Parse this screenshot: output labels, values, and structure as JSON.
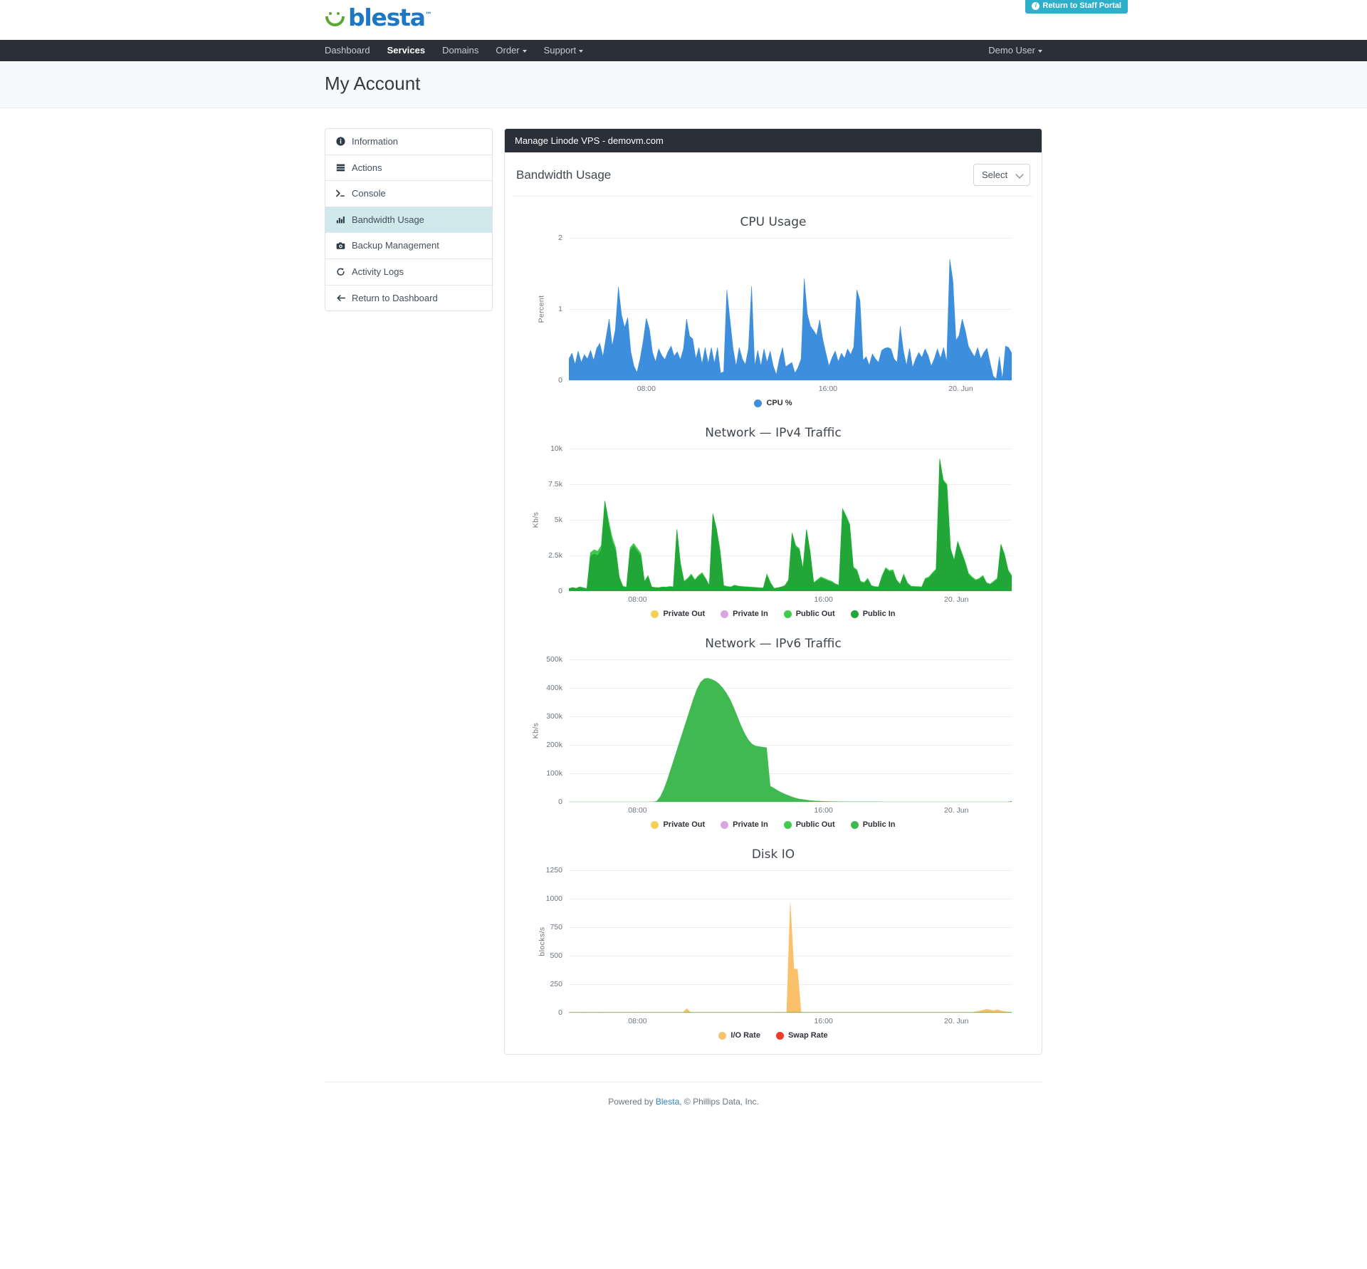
{
  "brand": {
    "logo_text": "blesta",
    "trademark": "™"
  },
  "staff_portal": {
    "label": "Return to Staff Portal",
    "icon": "info-icon",
    "color": "#2eb0ca"
  },
  "nav": {
    "items": [
      {
        "label": "Dashboard",
        "active": false,
        "caret": false
      },
      {
        "label": "Services",
        "active": true,
        "caret": false
      },
      {
        "label": "Domains",
        "active": false,
        "caret": false
      },
      {
        "label": "Order",
        "active": false,
        "caret": true
      },
      {
        "label": "Support",
        "active": false,
        "caret": true
      }
    ],
    "user": {
      "label": "Demo User",
      "caret": true
    }
  },
  "page": {
    "title": "My Account"
  },
  "sidebar": {
    "items": [
      {
        "label": "Information",
        "icon": "info-circle-icon",
        "glyph": "ℹ",
        "active": false
      },
      {
        "label": "Actions",
        "icon": "server-icon",
        "glyph": "☰",
        "active": false
      },
      {
        "label": "Console",
        "icon": "terminal-icon",
        "glyph": ">_",
        "active": false
      },
      {
        "label": "Bandwidth Usage",
        "icon": "chart-bar-icon",
        "glyph": "ᵛ",
        "active": true
      },
      {
        "label": "Backup Management",
        "icon": "camera-icon",
        "glyph": "▣",
        "active": false
      },
      {
        "label": "Activity Logs",
        "icon": "history-icon",
        "glyph": "↺",
        "active": false
      },
      {
        "label": "Return to Dashboard",
        "icon": "arrow-left-icon",
        "glyph": "←",
        "active": false
      }
    ]
  },
  "panel": {
    "header": "Manage Linode VPS - demovm.com",
    "section_title": "Bandwidth Usage",
    "select": {
      "value": "Select",
      "options": [
        "Select"
      ]
    }
  },
  "footer": {
    "prefix": "Powered by ",
    "link": "Blesta",
    "suffix": ", © Phillips Data, Inc."
  },
  "chart_data": [
    {
      "id": "cpu",
      "type": "area",
      "title": "CPU Usage",
      "ylabel": "Percent",
      "xlabel": "",
      "grid": true,
      "legend_position": "bottom",
      "ylim": [
        0,
        2
      ],
      "yticks": [
        0,
        1,
        2
      ],
      "ytick_labels": [
        "0",
        "1",
        "2"
      ],
      "xtick_labels": [
        "08:00",
        "16:00",
        "20. Jun"
      ],
      "xtick_positions": [
        0.175,
        0.585,
        0.885
      ],
      "series": [
        {
          "name": "CPU %",
          "color": "#3e8ede",
          "values": [
            0.3,
            0.38,
            0.22,
            0.41,
            0.25,
            0.36,
            0.3,
            0.42,
            0.28,
            0.45,
            0.52,
            0.33,
            0.6,
            0.86,
            0.48,
            0.71,
            1.31,
            0.92,
            0.74,
            0.88,
            0.4,
            0.2,
            0.11,
            0.3,
            0.55,
            0.87,
            0.72,
            0.39,
            0.26,
            0.44,
            0.35,
            0.29,
            0.4,
            0.48,
            0.34,
            0.4,
            0.29,
            0.44,
            0.86,
            0.62,
            0.58,
            0.3,
            0.46,
            0.23,
            0.46,
            0.24,
            0.46,
            0.24,
            0.46,
            0.1,
            0.12,
            1.27,
            0.86,
            0.45,
            0.2,
            0.46,
            0.3,
            0.22,
            0.45,
            1.32,
            0.2,
            0.42,
            0.2,
            0.44,
            0.25,
            0.41,
            0.2,
            0.08,
            0.3,
            0.46,
            0.19,
            0.22,
            0.25,
            0.1,
            0.18,
            0.3,
            1.43,
            0.93,
            0.76,
            0.7,
            0.63,
            0.85,
            0.57,
            0.38,
            0.2,
            0.32,
            0.41,
            0.26,
            0.38,
            0.31,
            0.44,
            0.36,
            0.47,
            1.27,
            1.12,
            0.28,
            0.33,
            0.21,
            0.37,
            0.3,
            0.25,
            0.42,
            0.45,
            0.46,
            0.44,
            0.3,
            0.25,
            0.76,
            0.42,
            0.21,
            0.45,
            0.18,
            0.3,
            0.39,
            0.32,
            0.44,
            0.35,
            0.2,
            0.3,
            0.44,
            0.31,
            0.46,
            0.26,
            1.7,
            1.4,
            0.56,
            0.63,
            0.86,
            0.7,
            0.48,
            0.4,
            0.33,
            0.46,
            0.3,
            0.39,
            0.45,
            0.25,
            0.06,
            0.02,
            0.33,
            0.02,
            0.48,
            0.46,
            0.38
          ]
        }
      ]
    },
    {
      "id": "ipv4",
      "type": "area",
      "title": "Network — IPv4 Traffic",
      "ylabel": "Kb/s",
      "xlabel": "",
      "grid": true,
      "legend_position": "bottom",
      "ylim": [
        0,
        10000
      ],
      "yticks": [
        0,
        2500,
        5000,
        7500,
        10000
      ],
      "ytick_labels": [
        "0",
        "2.5k",
        "5k",
        "7.5k",
        "10k"
      ],
      "xtick_labels": [
        "08:00",
        "16:00",
        "20. Jun"
      ],
      "xtick_positions": [
        0.155,
        0.575,
        0.875
      ],
      "series": [
        {
          "name": "Private Out",
          "color": "#f6cf59",
          "values": []
        },
        {
          "name": "Private In",
          "color": "#d9a6e0",
          "values": []
        },
        {
          "name": "Public Out",
          "color": "#3fcb4b",
          "values": [
            180,
            260,
            200,
            300,
            240,
            180,
            2700,
            2900,
            2800,
            3200,
            6350,
            5000,
            3800,
            3050,
            1000,
            350,
            280,
            3050,
            3350,
            3000,
            2650,
            700,
            1100,
            300,
            260,
            250,
            300,
            280,
            330,
            300,
            4350,
            2000,
            700,
            900,
            1200,
            800,
            1100,
            1300,
            900,
            420,
            5450,
            4400,
            2900,
            400,
            330,
            300,
            420,
            360,
            330,
            310,
            300,
            280,
            260,
            240,
            220,
            1200,
            600,
            200,
            240,
            300,
            400,
            800,
            4100,
            3200,
            3000,
            1600,
            4350,
            2800,
            600,
            800,
            1000,
            900,
            780,
            700,
            520,
            430,
            5800,
            5300,
            4700,
            1700,
            1500,
            700,
            600,
            900,
            400,
            320,
            300,
            1100,
            1650,
            1450,
            1500,
            800,
            500,
            1200,
            600,
            350,
            330,
            320,
            300,
            900,
            1000,
            1300,
            1550,
            9300,
            7800,
            7500,
            3000,
            2200,
            3500,
            2800,
            2100,
            1250,
            1000,
            800,
            900,
            1100,
            600,
            500,
            700,
            900,
            3300,
            2600,
            1500,
            1100
          ]
        },
        {
          "name": "Public In",
          "color": "#21a637",
          "values": [
            150,
            230,
            170,
            270,
            210,
            150,
            2450,
            2600,
            2500,
            2900,
            6300,
            4700,
            3500,
            2800,
            900,
            300,
            250,
            2850,
            3150,
            2800,
            2450,
            620,
            1000,
            260,
            230,
            220,
            270,
            250,
            300,
            270,
            4300,
            1800,
            620,
            820,
            1100,
            720,
            1000,
            1200,
            820,
            380,
            5400,
            4300,
            2700,
            350,
            290,
            260,
            380,
            320,
            290,
            270,
            260,
            240,
            220,
            200,
            190,
            1100,
            540,
            170,
            210,
            270,
            360,
            720,
            4000,
            3100,
            2900,
            1500,
            4300,
            2700,
            540,
            720,
            900,
            820,
            700,
            620,
            460,
            380,
            5700,
            5200,
            4600,
            1600,
            1400,
            620,
            540,
            820,
            350,
            280,
            260,
            1000,
            1550,
            1350,
            1400,
            720,
            450,
            1100,
            540,
            310,
            290,
            280,
            260,
            820,
            900,
            1200,
            1450,
            9250,
            7700,
            7400,
            2900,
            2100,
            3400,
            2700,
            2000,
            1150,
            900,
            720,
            820,
            1000,
            540,
            450,
            620,
            820,
            3250,
            2500,
            1400,
            1000
          ]
        }
      ]
    },
    {
      "id": "ipv6",
      "type": "area",
      "title": "Network — IPv6 Traffic",
      "ylabel": "Kb/s",
      "xlabel": "",
      "grid": true,
      "legend_position": "bottom",
      "ylim": [
        0,
        500000
      ],
      "yticks": [
        0,
        100000,
        200000,
        300000,
        400000,
        500000
      ],
      "ytick_labels": [
        "0",
        "100k",
        "200k",
        "300k",
        "400k",
        "500k"
      ],
      "xtick_labels": [
        "08:00",
        "16:00",
        "20. Jun"
      ],
      "xtick_positions": [
        0.155,
        0.575,
        0.875
      ],
      "series": [
        {
          "name": "Private Out",
          "color": "#f6cf59",
          "values": []
        },
        {
          "name": "Private In",
          "color": "#d9a6e0",
          "values": []
        },
        {
          "name": "Public Out",
          "color": "#3fcb4b",
          "values": []
        },
        {
          "name": "Public In",
          "color": "#3fb950",
          "values": [
            0,
            0,
            0,
            0,
            0,
            0,
            0,
            0,
            0,
            0,
            0,
            0,
            0,
            0,
            0,
            0,
            0,
            0,
            0,
            0,
            0,
            0,
            0,
            0,
            2000,
            18000,
            45000,
            80000,
            120000,
            160000,
            200000,
            240000,
            280000,
            320000,
            360000,
            395000,
            420000,
            432000,
            434000,
            430000,
            424000,
            414000,
            400000,
            382000,
            360000,
            332000,
            300000,
            268000,
            240000,
            218000,
            203000,
            196000,
            194000,
            192000,
            190000,
            55000,
            48000,
            40000,
            33000,
            27000,
            22000,
            17000,
            13000,
            10000,
            8000,
            6000,
            4500,
            3400,
            2600,
            2000,
            1500,
            1200,
            900,
            700,
            550,
            420,
            330,
            260,
            200,
            160,
            130,
            100,
            80,
            65,
            50,
            40,
            35,
            30,
            25,
            22,
            20,
            18,
            16,
            15,
            14,
            13,
            12,
            11,
            10,
            10,
            10,
            10,
            10,
            10,
            10,
            10,
            10,
            10,
            10,
            10,
            10,
            10,
            10,
            10,
            10,
            10,
            10,
            10,
            10,
            10,
            10,
            2000
          ]
        }
      ]
    },
    {
      "id": "disk",
      "type": "area",
      "title": "Disk IO",
      "ylabel": "blocks/s",
      "xlabel": "",
      "grid": true,
      "legend_position": "bottom",
      "ylim": [
        0,
        1250
      ],
      "yticks": [
        0,
        250,
        500,
        750,
        1000,
        1250
      ],
      "ytick_labels": [
        "0",
        "250",
        "500",
        "750",
        "1000",
        "1250"
      ],
      "xtick_labels": [
        "08:00",
        "16:00",
        "20. Jun"
      ],
      "xtick_positions": [
        0.155,
        0.575,
        0.875
      ],
      "series": [
        {
          "name": "I/O Rate",
          "color": "#fbc06a",
          "values": [
            2,
            2,
            2,
            2,
            3,
            2,
            2,
            2,
            2,
            3,
            2,
            2,
            2,
            2,
            2,
            2,
            2,
            2,
            2,
            3,
            2,
            2,
            2,
            2,
            2,
            2,
            2,
            2,
            2,
            2,
            2,
            2,
            2,
            35,
            5,
            2,
            2,
            2,
            2,
            2,
            2,
            2,
            2,
            2,
            2,
            2,
            2,
            2,
            2,
            2,
            2,
            2,
            2,
            2,
            2,
            2,
            2,
            2,
            3,
            2,
            2,
            2,
            960,
            385,
            380,
            5,
            2,
            2,
            2,
            2,
            2,
            2,
            2,
            2,
            2,
            2,
            2,
            2,
            2,
            2,
            2,
            2,
            2,
            2,
            2,
            2,
            2,
            2,
            2,
            2,
            2,
            2,
            2,
            2,
            2,
            2,
            2,
            2,
            2,
            2,
            2,
            2,
            2,
            2,
            2,
            2,
            2,
            2,
            2,
            2,
            2,
            2,
            2,
            2,
            8,
            14,
            22,
            30,
            24,
            18,
            26,
            16,
            10,
            6,
            4
          ]
        },
        {
          "name": "Swap Rate",
          "color": "#ef3b2c",
          "values": [
            1,
            1,
            1,
            1,
            1,
            1,
            1,
            1,
            1,
            1,
            1,
            1,
            1,
            1,
            1,
            1,
            1,
            1,
            1,
            1,
            1,
            1,
            1,
            1,
            1,
            1,
            1,
            1,
            1,
            1,
            1,
            1,
            1,
            1,
            1,
            1,
            1,
            1,
            1,
            1,
            1,
            1,
            1,
            1,
            1,
            1,
            1,
            1,
            1,
            1,
            1,
            1,
            1,
            1,
            1,
            1,
            1,
            1,
            1,
            1,
            1,
            1,
            1,
            1,
            1,
            1,
            1,
            1,
            1,
            1,
            1,
            1,
            1,
            1,
            1,
            1,
            1,
            1,
            1,
            1,
            1,
            1,
            1,
            1,
            1,
            1,
            1,
            1,
            1,
            1,
            1,
            1,
            1,
            1,
            1,
            1,
            1,
            1,
            1,
            1,
            1,
            1,
            1,
            1,
            1,
            1,
            1,
            1,
            1,
            1,
            1,
            1,
            1,
            1,
            1,
            1,
            1,
            1,
            1,
            1,
            1,
            1,
            1,
            1,
            1
          ]
        }
      ]
    }
  ]
}
